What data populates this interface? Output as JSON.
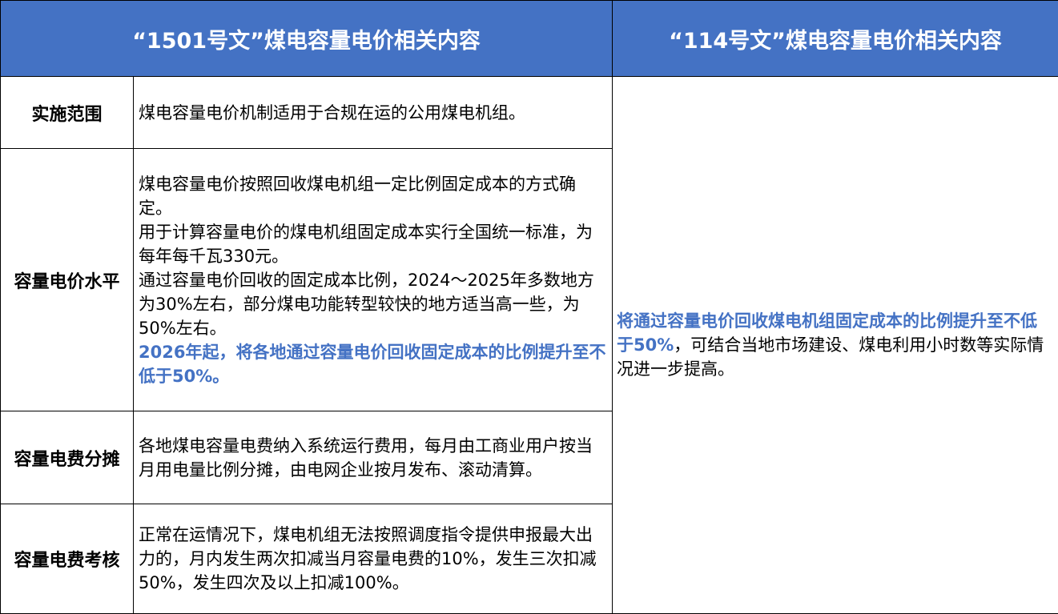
{
  "header": {
    "col_left": "“1501号文”煤电容量电价相关内容",
    "col_right": "“114号文”煤电容量电价相关内容"
  },
  "rows": [
    {
      "label": "实施范围",
      "paragraphs": [
        "煤电容量电价机制适用于合规在运的公用煤电机组。"
      ]
    },
    {
      "label": "容量电价水平",
      "paragraphs": [
        "煤电容量电价按照回收煤电机组一定比例固定成本的方式确定。",
        "用于计算容量电价的煤电机组固定成本实行全国统一标准，为每年每千瓦330元。",
        "通过容量电价回收的固定成本比例，2024～2025年多数地方为30%左右，部分煤电功能转型较快的地方适当高一些，为50%左右。"
      ],
      "highlight": "2026年起，将各地通过容量电价回收固定成本的比例提升至不低于50%。"
    },
    {
      "label": "容量电费分摊",
      "paragraphs": [
        "各地煤电容量电费纳入系统运行费用，每月由工商业用户按当月用电量比例分摊，由电网企业按月发布、滚动清算。"
      ]
    },
    {
      "label": "容量电费考核",
      "paragraphs": [
        "正常在运情况下，煤电机组无法按照调度指令提供申报最大出力的，月内发生两次扣减当月容量电费的10%，发生三次扣减50%，发生四次及以上扣减100%。"
      ]
    }
  ],
  "right_content": {
    "highlight": "将通过容量电价回收煤电机组固定成本的比例提升至不低于50%",
    "text": "，可结合当地市场建设、煤电利用小时数等实际情况进一步提高。"
  },
  "colors": {
    "header_bg": "#4472c4",
    "header_text": "#ffffff",
    "highlight": "#4472c4",
    "border": "#000000"
  }
}
